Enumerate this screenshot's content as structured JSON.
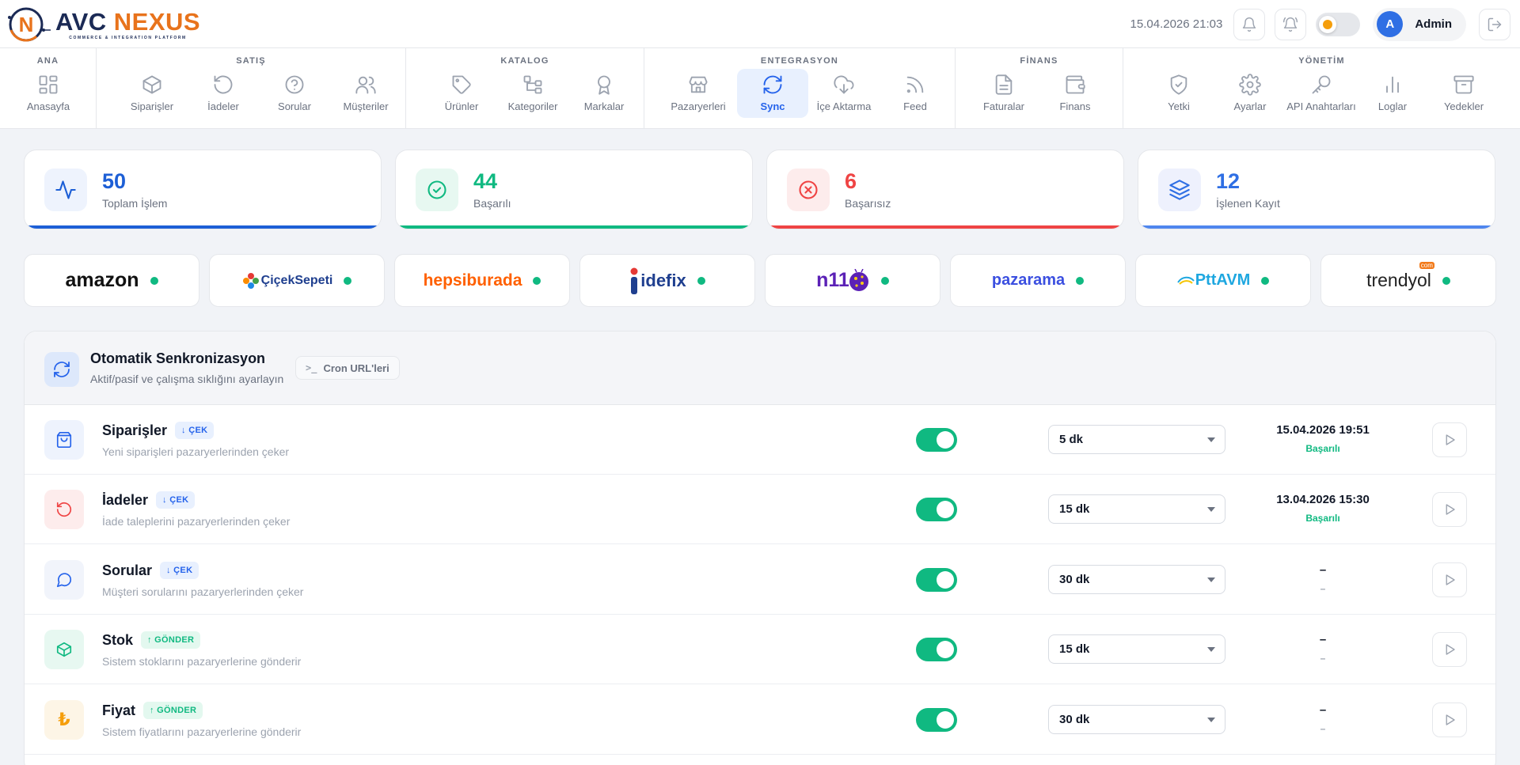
{
  "brand": {
    "name_part1": "AVC",
    "name_part2": "NEXUS",
    "tagline": "COMMERCE & INTEGRATION PLATFORM",
    "logo_letter": "N"
  },
  "header": {
    "datetime": "15.04.2026 21:03",
    "user_initial": "A",
    "user_name": "Admin"
  },
  "nav": {
    "ana": {
      "title": "ANA",
      "items": [
        "Anasayfa"
      ]
    },
    "satis": {
      "title": "SATIŞ",
      "items": [
        "Siparişler",
        "İadeler",
        "Sorular",
        "Müşteriler"
      ]
    },
    "katalog": {
      "title": "KATALOG",
      "items": [
        "Ürünler",
        "Kategoriler",
        "Markalar"
      ]
    },
    "entegrasyon": {
      "title": "ENTEGRASYON",
      "items": [
        "Pazaryerleri",
        "Sync",
        "İçe Aktarma",
        "Feed"
      ]
    },
    "finans": {
      "title": "FİNANS",
      "items": [
        "Faturalar",
        "Finans"
      ]
    },
    "yonetim": {
      "title": "YÖNETİM",
      "items": [
        "Yetki",
        "Ayarlar",
        "API Anahtarları",
        "Loglar",
        "Yedekler"
      ]
    },
    "active": "Sync"
  },
  "stats": [
    {
      "value": "50",
      "label": "Toplam İşlem",
      "color": "#1d5fd6",
      "bg": "#eef3fd"
    },
    {
      "value": "44",
      "label": "Başarılı",
      "color": "#10b981",
      "bg": "#e7f8f1"
    },
    {
      "value": "6",
      "label": "Başarısız",
      "color": "#ef4444",
      "bg": "#fdecec"
    },
    {
      "value": "12",
      "label": "İşlenen Kayıt",
      "color": "#2f6fe4",
      "bg": "#eef1fd"
    }
  ],
  "marketplaces": [
    {
      "name": "amazon",
      "status": "active"
    },
    {
      "name": "ÇiçekSepeti",
      "status": "active"
    },
    {
      "name": "hepsiburada",
      "status": "active"
    },
    {
      "name": "idefix",
      "status": "active"
    },
    {
      "name": "n11",
      "status": "active"
    },
    {
      "name": "pazarama",
      "status": "active"
    },
    {
      "name": "PttAVM",
      "status": "active"
    },
    {
      "name": "trendyol",
      "badge": "com",
      "status": "active"
    }
  ],
  "sync": {
    "title": "Otomatik Senkronizasyon",
    "subtitle": "Aktif/pasif ve çalışma sıklığını ayarlayın",
    "cron_label": "Cron URL'leri",
    "cron_icon": ">_",
    "rows": [
      {
        "name": "Siparişler",
        "badge": "↓ ÇEK",
        "direction": "pull",
        "desc": "Yeni siparişleri pazaryerlerinden çeker",
        "enabled": true,
        "interval": "5 dk",
        "last_run": "15.04.2026 19:51",
        "last_status": "Başarılı",
        "icon": "bag-icon",
        "color": "#2563eb",
        "bg": "#eef3fd"
      },
      {
        "name": "İadeler",
        "badge": "↓ ÇEK",
        "direction": "pull",
        "desc": "İade taleplerini pazaryerlerinden çeker",
        "enabled": true,
        "interval": "15 dk",
        "last_run": "13.04.2026 15:30",
        "last_status": "Başarılı",
        "icon": "undo-icon",
        "color": "#ef4444",
        "bg": "#fdecec"
      },
      {
        "name": "Sorular",
        "badge": "↓ ÇEK",
        "direction": "pull",
        "desc": "Müşteri sorularını pazaryerlerinden çeker",
        "enabled": true,
        "interval": "30 dk",
        "last_run": "–",
        "last_status": "–",
        "icon": "chat-icon",
        "color": "#2563eb",
        "bg": "#f1f4fb"
      },
      {
        "name": "Stok",
        "badge": "↑ GÖNDER",
        "direction": "push",
        "desc": "Sistem stoklarını pazaryerlerine gönderir",
        "enabled": true,
        "interval": "15 dk",
        "last_run": "–",
        "last_status": "–",
        "icon": "box-icon",
        "color": "#10b981",
        "bg": "#e7f8f1"
      },
      {
        "name": "Fiyat",
        "badge": "↑ GÖNDER",
        "direction": "push",
        "desc": "Sistem fiyatlarını pazaryerlerine gönderir",
        "enabled": true,
        "interval": "30 dk",
        "last_run": "–",
        "last_status": "–",
        "icon": "lira-icon",
        "color": "#f59e0b",
        "bg": "#fdf5e6"
      }
    ]
  }
}
